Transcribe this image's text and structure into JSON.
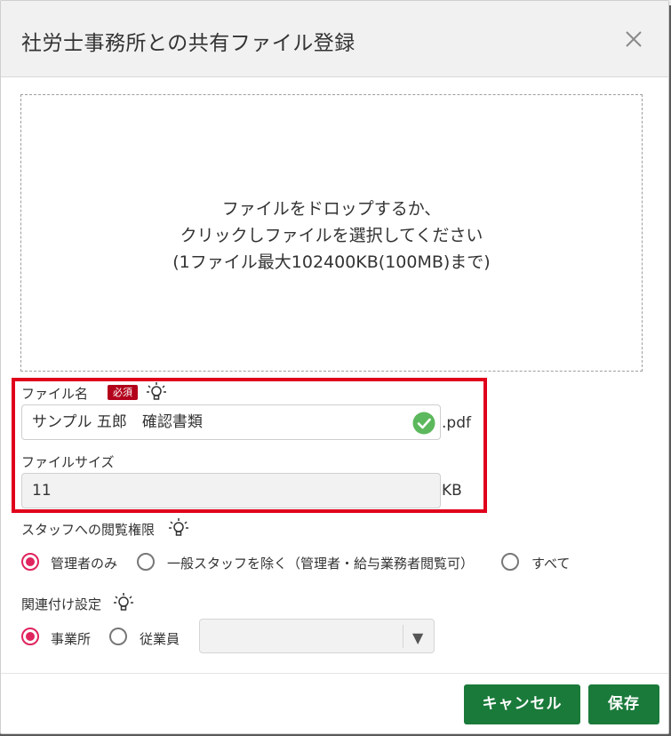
{
  "dialog": {
    "title": "社労士事務所との共有ファイル登録",
    "close_icon": "close-icon"
  },
  "dropzone": {
    "line1": "ファイルをドロップするか、",
    "line2": "クリックしファイルを選択してください",
    "line3": "(1ファイル最大102400KB(100MB)まで)"
  },
  "file_name": {
    "label": "ファイル名",
    "required_badge": "必須",
    "value": "サンプル 五郎　確認書類",
    "extension": ".pdf",
    "status_icon": "check-circle-icon"
  },
  "file_size": {
    "label": "ファイルサイズ",
    "value": "11",
    "unit": "KB"
  },
  "staff_permission": {
    "label": "スタッフへの閲覧権限",
    "options": [
      {
        "label": "管理者のみ",
        "selected": true
      },
      {
        "label": "一般スタッフを除く（管理者・給与業務者閲覧可）",
        "selected": false
      },
      {
        "label": "すべて",
        "selected": false
      }
    ]
  },
  "association": {
    "label": "関連付け設定",
    "options": [
      {
        "label": "事業所",
        "selected": true
      },
      {
        "label": "従業員",
        "selected": false
      }
    ],
    "select_value": "",
    "select_arrow": "▼"
  },
  "footer": {
    "cancel_label": "キャンセル",
    "save_label": "保存"
  },
  "colors": {
    "primary_button": "#1a7a3a",
    "highlight_border": "#e0001b",
    "radio_selected": "#e0245e",
    "required_badge": "#b3001b",
    "check_green": "#5cb85c"
  }
}
